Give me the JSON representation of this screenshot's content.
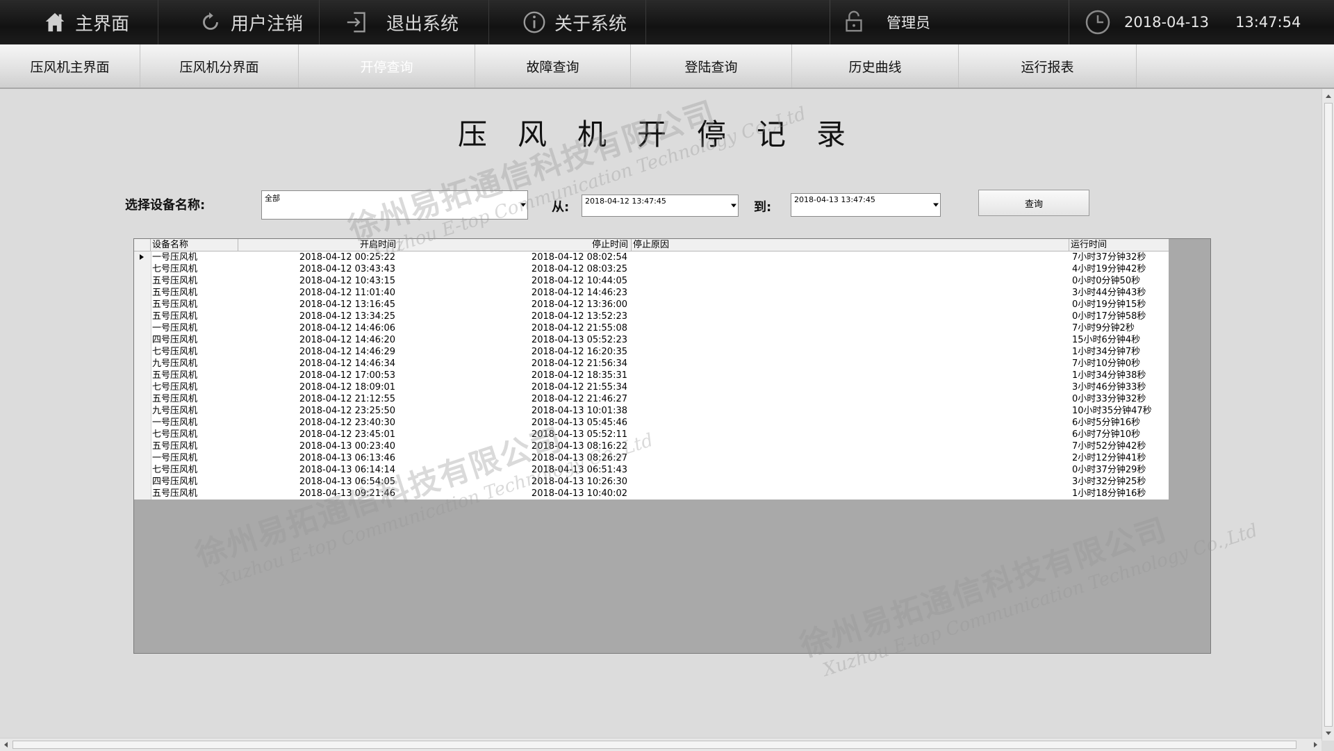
{
  "topbar": {
    "home_label": "主界面",
    "logout_label": "用户注销",
    "exit_label": "退出系统",
    "about_label": "关于系统",
    "user_label": "管理员",
    "date": "2018-04-13",
    "time": "13:47:54"
  },
  "nav": {
    "items": [
      {
        "label": "压风机主界面"
      },
      {
        "label": "压风机分界面"
      },
      {
        "label": "开停查询"
      },
      {
        "label": "故障查询"
      },
      {
        "label": "登陆查询"
      },
      {
        "label": "历史曲线"
      },
      {
        "label": "运行报表"
      }
    ]
  },
  "page": {
    "title": "压风机开停记录"
  },
  "filters": {
    "device_label": "选择设备名称:",
    "device_value": "全部",
    "from_label": "从:",
    "from_value": "2018-04-12 13:47:45",
    "to_label": "到:",
    "to_value": "2018-04-13 13:47:45",
    "query_label": "查询"
  },
  "table": {
    "headers": {
      "name": "设备名称",
      "start": "开启时间",
      "stop": "停止时间",
      "reason": "停止原因",
      "run": "运行时间"
    },
    "rows": [
      {
        "name": "一号压风机",
        "start": "2018-04-12 00:25:22",
        "stop": "2018-04-12 08:02:54",
        "reason": "",
        "run": "7小时37分钟32秒"
      },
      {
        "name": "七号压风机",
        "start": "2018-04-12 03:43:43",
        "stop": "2018-04-12 08:03:25",
        "reason": "",
        "run": "4小时19分钟42秒"
      },
      {
        "name": "五号压风机",
        "start": "2018-04-12 10:43:15",
        "stop": "2018-04-12 10:44:05",
        "reason": "",
        "run": "0小时0分钟50秒"
      },
      {
        "name": "五号压风机",
        "start": "2018-04-12 11:01:40",
        "stop": "2018-04-12 14:46:23",
        "reason": "",
        "run": "3小时44分钟43秒"
      },
      {
        "name": "五号压风机",
        "start": "2018-04-12 13:16:45",
        "stop": "2018-04-12 13:36:00",
        "reason": "",
        "run": "0小时19分钟15秒"
      },
      {
        "name": "五号压风机",
        "start": "2018-04-12 13:34:25",
        "stop": "2018-04-12 13:52:23",
        "reason": "",
        "run": "0小时17分钟58秒"
      },
      {
        "name": "一号压风机",
        "start": "2018-04-12 14:46:06",
        "stop": "2018-04-12 21:55:08",
        "reason": "",
        "run": "7小时9分钟2秒"
      },
      {
        "name": "四号压风机",
        "start": "2018-04-12 14:46:20",
        "stop": "2018-04-13 05:52:23",
        "reason": "",
        "run": "15小时6分钟4秒"
      },
      {
        "name": "七号压风机",
        "start": "2018-04-12 14:46:29",
        "stop": "2018-04-12 16:20:35",
        "reason": "",
        "run": "1小时34分钟7秒"
      },
      {
        "name": "九号压风机",
        "start": "2018-04-12 14:46:34",
        "stop": "2018-04-12 21:56:34",
        "reason": "",
        "run": "7小时10分钟0秒"
      },
      {
        "name": "五号压风机",
        "start": "2018-04-12 17:00:53",
        "stop": "2018-04-12 18:35:31",
        "reason": "",
        "run": "1小时34分钟38秒"
      },
      {
        "name": "七号压风机",
        "start": "2018-04-12 18:09:01",
        "stop": "2018-04-12 21:55:34",
        "reason": "",
        "run": "3小时46分钟33秒"
      },
      {
        "name": "五号压风机",
        "start": "2018-04-12 21:12:55",
        "stop": "2018-04-12 21:46:27",
        "reason": "",
        "run": "0小时33分钟32秒"
      },
      {
        "name": "九号压风机",
        "start": "2018-04-12 23:25:50",
        "stop": "2018-04-13 10:01:38",
        "reason": "",
        "run": "10小时35分钟47秒"
      },
      {
        "name": "一号压风机",
        "start": "2018-04-12 23:40:30",
        "stop": "2018-04-13 05:45:46",
        "reason": "",
        "run": "6小时5分钟16秒"
      },
      {
        "name": "七号压风机",
        "start": "2018-04-12 23:45:01",
        "stop": "2018-04-13 05:52:11",
        "reason": "",
        "run": "6小时7分钟10秒"
      },
      {
        "name": "五号压风机",
        "start": "2018-04-13 00:23:40",
        "stop": "2018-04-13 08:16:22",
        "reason": "",
        "run": "7小时52分钟42秒"
      },
      {
        "name": "一号压风机",
        "start": "2018-04-13 06:13:46",
        "stop": "2018-04-13 08:26:27",
        "reason": "",
        "run": "2小时12分钟41秒"
      },
      {
        "name": "七号压风机",
        "start": "2018-04-13 06:14:14",
        "stop": "2018-04-13 06:51:43",
        "reason": "",
        "run": "0小时37分钟29秒"
      },
      {
        "name": "四号压风机",
        "start": "2018-04-13 06:54:05",
        "stop": "2018-04-13 10:26:30",
        "reason": "",
        "run": "3小时32分钟25秒"
      },
      {
        "name": "五号压风机",
        "start": "2018-04-13 09:21:46",
        "stop": "2018-04-13 10:40:02",
        "reason": "",
        "run": "1小时18分钟16秒"
      }
    ]
  },
  "watermark": {
    "cn": "徐州易拓通信科技有限公司",
    "en": "Xuzhou E-top Communication Technology Co.,Ltd"
  },
  "colors": {
    "topbar": "#1a1a1a",
    "nav_active_text": "#ffffff",
    "grid_empty": "#a9a9a9"
  }
}
